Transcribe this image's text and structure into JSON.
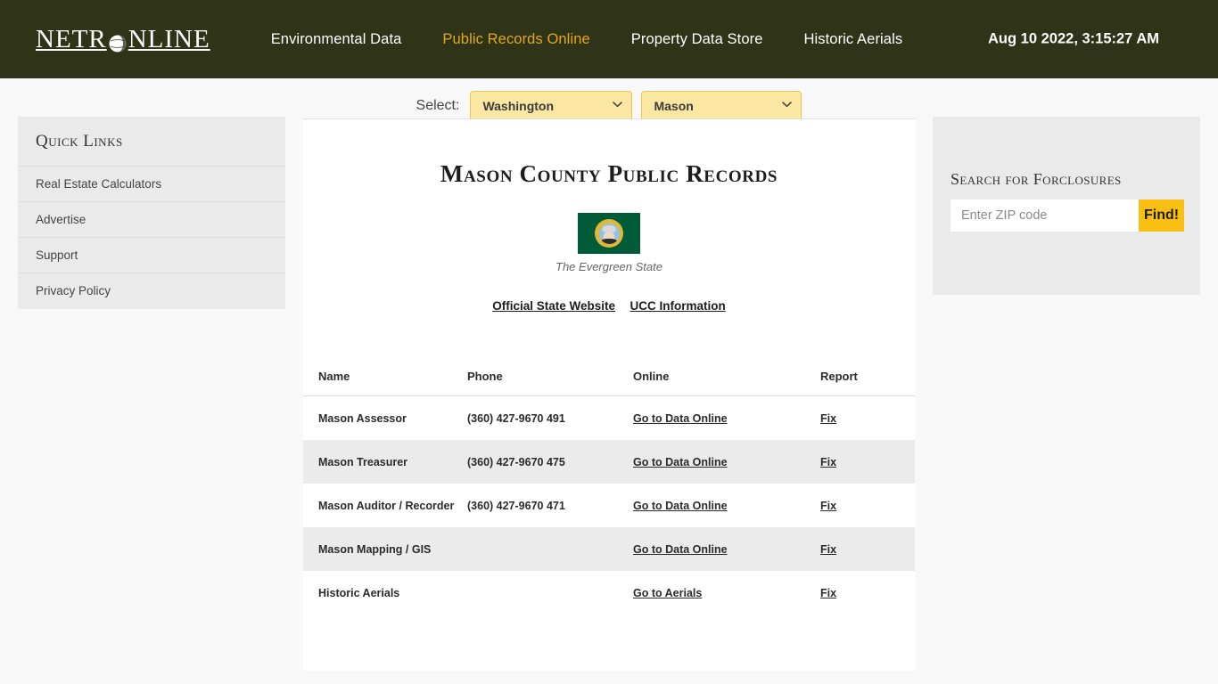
{
  "header": {
    "logo_text_before": "NETR",
    "logo_icon": "globe-icon",
    "logo_text_after": "NLINE",
    "nav": [
      {
        "label": "Environmental Data",
        "active": false
      },
      {
        "label": "Public Records Online",
        "active": true
      },
      {
        "label": "Property Data Store",
        "active": false
      },
      {
        "label": "Historic Aerials",
        "active": false
      }
    ],
    "clock": "Aug 10 2022, 3:15:27 AM",
    "background_color": "#2F3418",
    "active_link_color": "#E0A81E"
  },
  "sidebar_left": {
    "title": "Quick Links",
    "items": [
      {
        "label": "Real Estate Calculators"
      },
      {
        "label": "Advertise"
      },
      {
        "label": "Support"
      },
      {
        "label": "Privacy Policy"
      }
    ]
  },
  "select_bar": {
    "label": "Select:",
    "state": {
      "value": "Washington",
      "options": [
        "Washington"
      ]
    },
    "county": {
      "value": "Mason",
      "options": [
        "Mason"
      ]
    },
    "chevron": "⌄"
  },
  "main": {
    "title": "Mason County Public Records",
    "flag_caption": "The Evergreen State",
    "flag_alt": "washington-state-flag",
    "links": [
      {
        "label": "Official State Website"
      },
      {
        "label": "UCC Information"
      }
    ],
    "table": {
      "columns": [
        "Name",
        "Phone",
        "Online",
        "Report"
      ],
      "rows": [
        {
          "name": "Mason Assessor",
          "phone": "(360) 427-9670 491",
          "online": "Go to Data Online",
          "report": "Fix"
        },
        {
          "name": "Mason Treasurer",
          "phone": "(360) 427-9670 475",
          "online": "Go to Data Online",
          "report": "Fix"
        },
        {
          "name": "Mason Auditor / Recorder",
          "phone": "(360) 427-9670 471",
          "online": "Go to Data Online",
          "report": "Fix"
        },
        {
          "name": "Mason Mapping / GIS",
          "phone": "",
          "online": "Go to Data Online",
          "report": "Fix"
        },
        {
          "name": "Historic Aerials",
          "phone": "",
          "online": "Go to Aerials",
          "report": "Fix"
        }
      ]
    }
  },
  "sidebar_right": {
    "title": "Search for Forclosures",
    "zip_placeholder": "Enter ZIP code",
    "zip_value": "",
    "find_label": "Find!",
    "find_color": "#F9C013"
  }
}
